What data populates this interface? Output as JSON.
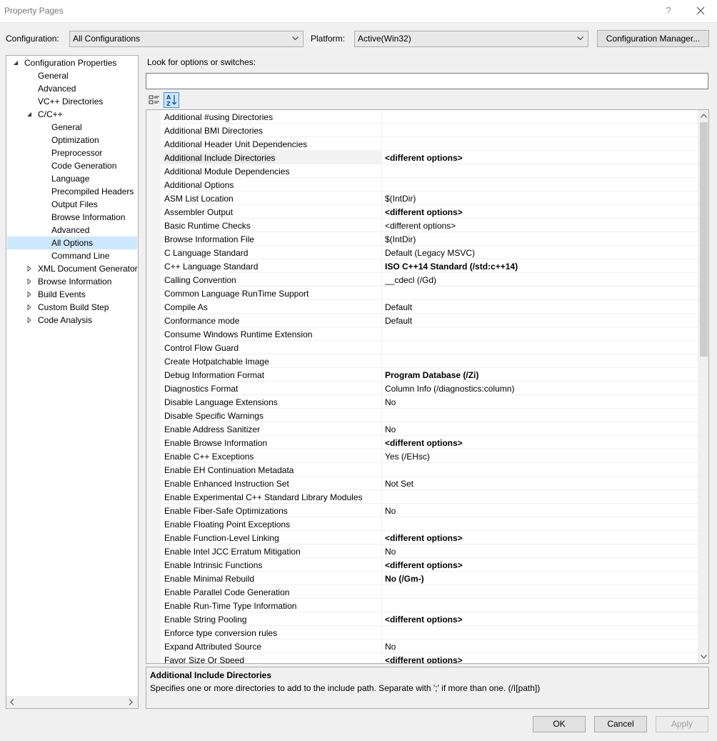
{
  "window": {
    "title": "Property Pages",
    "help": "?"
  },
  "config": {
    "configuration_label": "Configuration:",
    "configuration_value": "All Configurations",
    "platform_label": "Platform:",
    "platform_value": "Active(Win32)",
    "manager_button": "Configuration Manager..."
  },
  "tree": [
    {
      "label": "Configuration Properties",
      "level": 0,
      "expander": "expanded"
    },
    {
      "label": "General",
      "level": 1
    },
    {
      "label": "Advanced",
      "level": 1
    },
    {
      "label": "VC++ Directories",
      "level": 1
    },
    {
      "label": "C/C++",
      "level": 1,
      "expander": "expanded"
    },
    {
      "label": "General",
      "level": 2
    },
    {
      "label": "Optimization",
      "level": 2
    },
    {
      "label": "Preprocessor",
      "level": 2
    },
    {
      "label": "Code Generation",
      "level": 2
    },
    {
      "label": "Language",
      "level": 2
    },
    {
      "label": "Precompiled Headers",
      "level": 2
    },
    {
      "label": "Output Files",
      "level": 2
    },
    {
      "label": "Browse Information",
      "level": 2
    },
    {
      "label": "Advanced",
      "level": 2
    },
    {
      "label": "All Options",
      "level": 2,
      "selected": true
    },
    {
      "label": "Command Line",
      "level": 2
    },
    {
      "label": "XML Document Generator",
      "level": 1,
      "expander": "collapsed"
    },
    {
      "label": "Browse Information",
      "level": 1,
      "expander": "collapsed"
    },
    {
      "label": "Build Events",
      "level": 1,
      "expander": "collapsed"
    },
    {
      "label": "Custom Build Step",
      "level": 1,
      "expander": "collapsed"
    },
    {
      "label": "Code Analysis",
      "level": 1,
      "expander": "collapsed"
    }
  ],
  "search": {
    "label": "Look for options or switches:",
    "value": ""
  },
  "properties": [
    {
      "name": "Additional #using Directories",
      "value": ""
    },
    {
      "name": "Additional BMI Directories",
      "value": ""
    },
    {
      "name": "Additional Header Unit Dependencies",
      "value": ""
    },
    {
      "name": "Additional Include Directories",
      "value": "<different options>",
      "bold": true,
      "selected": true
    },
    {
      "name": "Additional Module Dependencies",
      "value": ""
    },
    {
      "name": "Additional Options",
      "value": ""
    },
    {
      "name": "ASM List Location",
      "value": "$(IntDir)"
    },
    {
      "name": "Assembler Output",
      "value": "<different options>",
      "bold": true
    },
    {
      "name": "Basic Runtime Checks",
      "value": "<different options>"
    },
    {
      "name": "Browse Information File",
      "value": "$(IntDir)"
    },
    {
      "name": "C Language Standard",
      "value": "Default (Legacy MSVC)"
    },
    {
      "name": "C++ Language Standard",
      "value": "ISO C++14 Standard (/std:c++14)",
      "bold": true
    },
    {
      "name": "Calling Convention",
      "value": "__cdecl (/Gd)"
    },
    {
      "name": "Common Language RunTime Support",
      "value": ""
    },
    {
      "name": "Compile As",
      "value": "Default"
    },
    {
      "name": "Conformance mode",
      "value": "Default"
    },
    {
      "name": "Consume Windows Runtime Extension",
      "value": ""
    },
    {
      "name": "Control Flow Guard",
      "value": ""
    },
    {
      "name": "Create Hotpatchable Image",
      "value": ""
    },
    {
      "name": "Debug Information Format",
      "value": "Program Database (/Zi)",
      "bold": true
    },
    {
      "name": "Diagnostics Format",
      "value": "Column Info (/diagnostics:column)"
    },
    {
      "name": "Disable Language Extensions",
      "value": "No"
    },
    {
      "name": "Disable Specific Warnings",
      "value": ""
    },
    {
      "name": "Enable Address Sanitizer",
      "value": "No"
    },
    {
      "name": "Enable Browse Information",
      "value": "<different options>",
      "bold": true
    },
    {
      "name": "Enable C++ Exceptions",
      "value": "Yes (/EHsc)"
    },
    {
      "name": "Enable EH Continuation Metadata",
      "value": ""
    },
    {
      "name": "Enable Enhanced Instruction Set",
      "value": "Not Set"
    },
    {
      "name": "Enable Experimental C++ Standard Library Modules",
      "value": ""
    },
    {
      "name": "Enable Fiber-Safe Optimizations",
      "value": "No"
    },
    {
      "name": "Enable Floating Point Exceptions",
      "value": ""
    },
    {
      "name": "Enable Function-Level Linking",
      "value": "<different options>",
      "bold": true
    },
    {
      "name": "Enable Intel JCC Erratum Mitigation",
      "value": "No"
    },
    {
      "name": "Enable Intrinsic Functions",
      "value": "<different options>",
      "bold": true
    },
    {
      "name": "Enable Minimal Rebuild",
      "value": "No (/Gm-)",
      "bold": true
    },
    {
      "name": "Enable Parallel Code Generation",
      "value": ""
    },
    {
      "name": "Enable Run-Time Type Information",
      "value": ""
    },
    {
      "name": "Enable String Pooling",
      "value": "<different options>",
      "bold": true
    },
    {
      "name": "Enforce type conversion rules",
      "value": ""
    },
    {
      "name": "Expand Attributed Source",
      "value": "No"
    },
    {
      "name": "Favor Size Or Speed",
      "value": "<different options>",
      "bold": true
    }
  ],
  "description": {
    "title": "Additional Include Directories",
    "text": "Specifies one or more directories to add to the include path. Separate with ';' if more than one.     (/I[path])"
  },
  "buttons": {
    "ok": "OK",
    "cancel": "Cancel",
    "apply": "Apply"
  }
}
